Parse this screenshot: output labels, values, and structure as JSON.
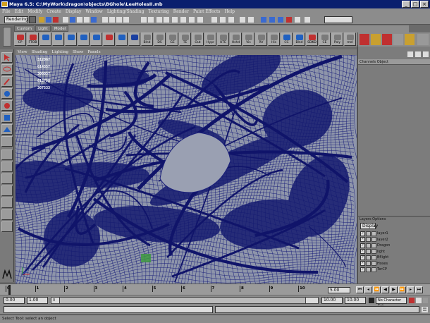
{
  "window": {
    "title": "Maya 6.5: C:\\MyWork\\dragon\\objects\\BGhole\\LeeHolesII.mb",
    "controls": [
      "_",
      "□",
      "×"
    ]
  },
  "menus": [
    "File",
    "Edit",
    "Modify",
    "Create",
    "Display",
    "Window",
    "Lighting/Shading",
    "Texturing",
    "Render",
    "Paint Effects",
    "Help"
  ],
  "status_line": {
    "mode_value": "Rendering"
  },
  "shelf": {
    "tabs": [
      "Custom",
      "Light",
      "Model"
    ],
    "icons": [
      {
        "label": "CP",
        "color": "#c03030"
      },
      {
        "label": "FTOB",
        "color": "#c03030"
      },
      {
        "label": "",
        "color": "#2060c0"
      },
      {
        "label": "",
        "color": "#2060c0"
      },
      {
        "label": "",
        "color": "#2060c0"
      },
      {
        "label": "",
        "color": "#2060c0"
      },
      {
        "label": "",
        "color": "#2060c0"
      },
      {
        "label": "",
        "color": "#c03030"
      },
      {
        "label": "",
        "color": "#2060c0"
      },
      {
        "label": "",
        "color": "#1a3fa0"
      },
      {
        "label": "Blnd",
        "color": "#7a7a7a"
      },
      {
        "label": "DS",
        "color": "#7a7a7a"
      },
      {
        "label": "GE",
        "color": "#7a7a7a"
      },
      {
        "label": "TE",
        "color": "#7a7a7a"
      },
      {
        "label": "Out",
        "color": "#7a7a7a"
      },
      {
        "label": "Hypr",
        "color": "#7a7a7a"
      },
      {
        "label": "UTE",
        "color": "#7a7a7a"
      },
      {
        "label": "Hshd",
        "color": "#7a7a7a"
      },
      {
        "label": "Vis",
        "color": "#7a7a7a"
      },
      {
        "label": "RV",
        "color": "#7a7a7a"
      },
      {
        "label": "His",
        "color": "#7a7a7a"
      },
      {
        "label": "CC",
        "color": "#2060c0"
      },
      {
        "label": "Blnd",
        "color": "#2060c0"
      },
      {
        "label": "SDKD",
        "color": "#c03030"
      },
      {
        "label": "CE",
        "color": "#7a7a7a"
      },
      {
        "label": "Poly Count",
        "color": "#7a7a7a"
      },
      {
        "label": "mel",
        "color": "#7a7a7a"
      },
      {
        "label": "",
        "color": "#2060c0"
      },
      {
        "label": "",
        "color": "#2060c0"
      },
      {
        "label": "SDKD",
        "color": "#c03030"
      }
    ]
  },
  "panel_menu": [
    "View",
    "Shading",
    "Lighting",
    "Show",
    "Panels"
  ],
  "hud": {
    "values": [
      "312067",
      "614357",
      "306057",
      "613798",
      "307533"
    ]
  },
  "right_panel": {
    "channel_header": "Channels  Object"
  },
  "layer_editor": {
    "header": "Layers  Options",
    "display_value": "Display",
    "layers": [
      "layer1",
      "layer2",
      "Dragon",
      "light",
      "Bflight",
      "Hoses",
      "TerCP"
    ]
  },
  "time_slider": {
    "ticks": [
      "0",
      "1",
      "2",
      "3",
      "4",
      "5",
      "6",
      "7",
      "8",
      "9",
      "10"
    ],
    "current_frame": "5.00"
  },
  "range_slider": {
    "start": "0.00",
    "playback_start": "1.00",
    "marker": "0",
    "playback_end": "10.00",
    "end": "10.00",
    "character_set": "No Character Set"
  },
  "help_line": "Select Tool: select an object"
}
